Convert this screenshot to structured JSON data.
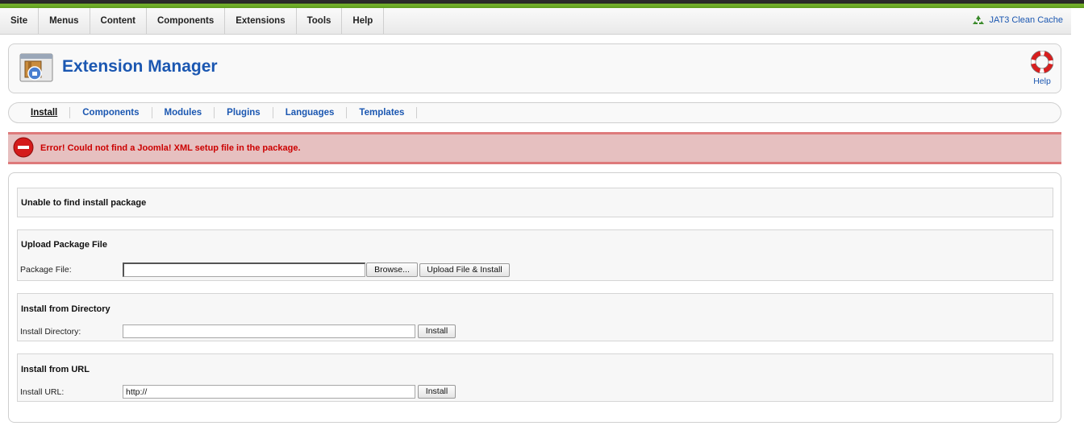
{
  "menubar": {
    "items": [
      "Site",
      "Menus",
      "Content",
      "Components",
      "Extensions",
      "Tools",
      "Help"
    ],
    "cache_link": "JAT3 Clean Cache"
  },
  "header": {
    "title": "Extension Manager",
    "help_label": "Help"
  },
  "tabs": [
    "Install",
    "Components",
    "Modules",
    "Plugins",
    "Languages",
    "Templates"
  ],
  "error": {
    "message": "Error! Could not find a Joomla! XML setup file in the package."
  },
  "sections": {
    "notice": {
      "title": "Unable to find install package"
    },
    "upload": {
      "title": "Upload Package File",
      "label": "Package File:",
      "value": "",
      "browse_label": "Browse...",
      "submit_label": "Upload File & Install"
    },
    "directory": {
      "title": "Install from Directory",
      "label": "Install Directory:",
      "value": "",
      "submit_label": "Install"
    },
    "url": {
      "title": "Install from URL",
      "label": "Install URL:",
      "value": "http://",
      "submit_label": "Install"
    }
  },
  "colors": {
    "link_blue": "#1b57b1",
    "brand_green": "#6aa82a",
    "error_red": "#cc0000",
    "error_bg": "#e6c0c0"
  }
}
